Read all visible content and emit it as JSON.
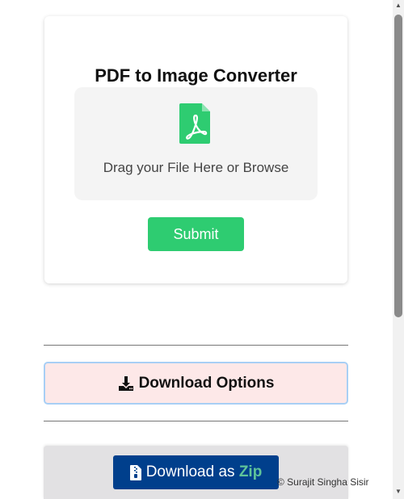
{
  "converter": {
    "title": "PDF to Image Converter",
    "dropzone_text": "Drag your File Here or Browse",
    "dropzone_icon": "pdf-file-icon",
    "submit_label": "Submit"
  },
  "download": {
    "options_label": "Download Options",
    "options_icon": "download-icon",
    "zip_prefix": "Download as ",
    "zip_highlight": "Zip",
    "zip_icon": "zip-file-icon"
  },
  "footer": {
    "copyright": "© Surajit Singha Sisir"
  },
  "colors": {
    "accent_green": "#2ecc71",
    "zip_button_blue": "#003f8c",
    "options_bg": "#fde8e8",
    "options_border": "#a8cff5",
    "zip_highlight": "#5fc39a"
  }
}
